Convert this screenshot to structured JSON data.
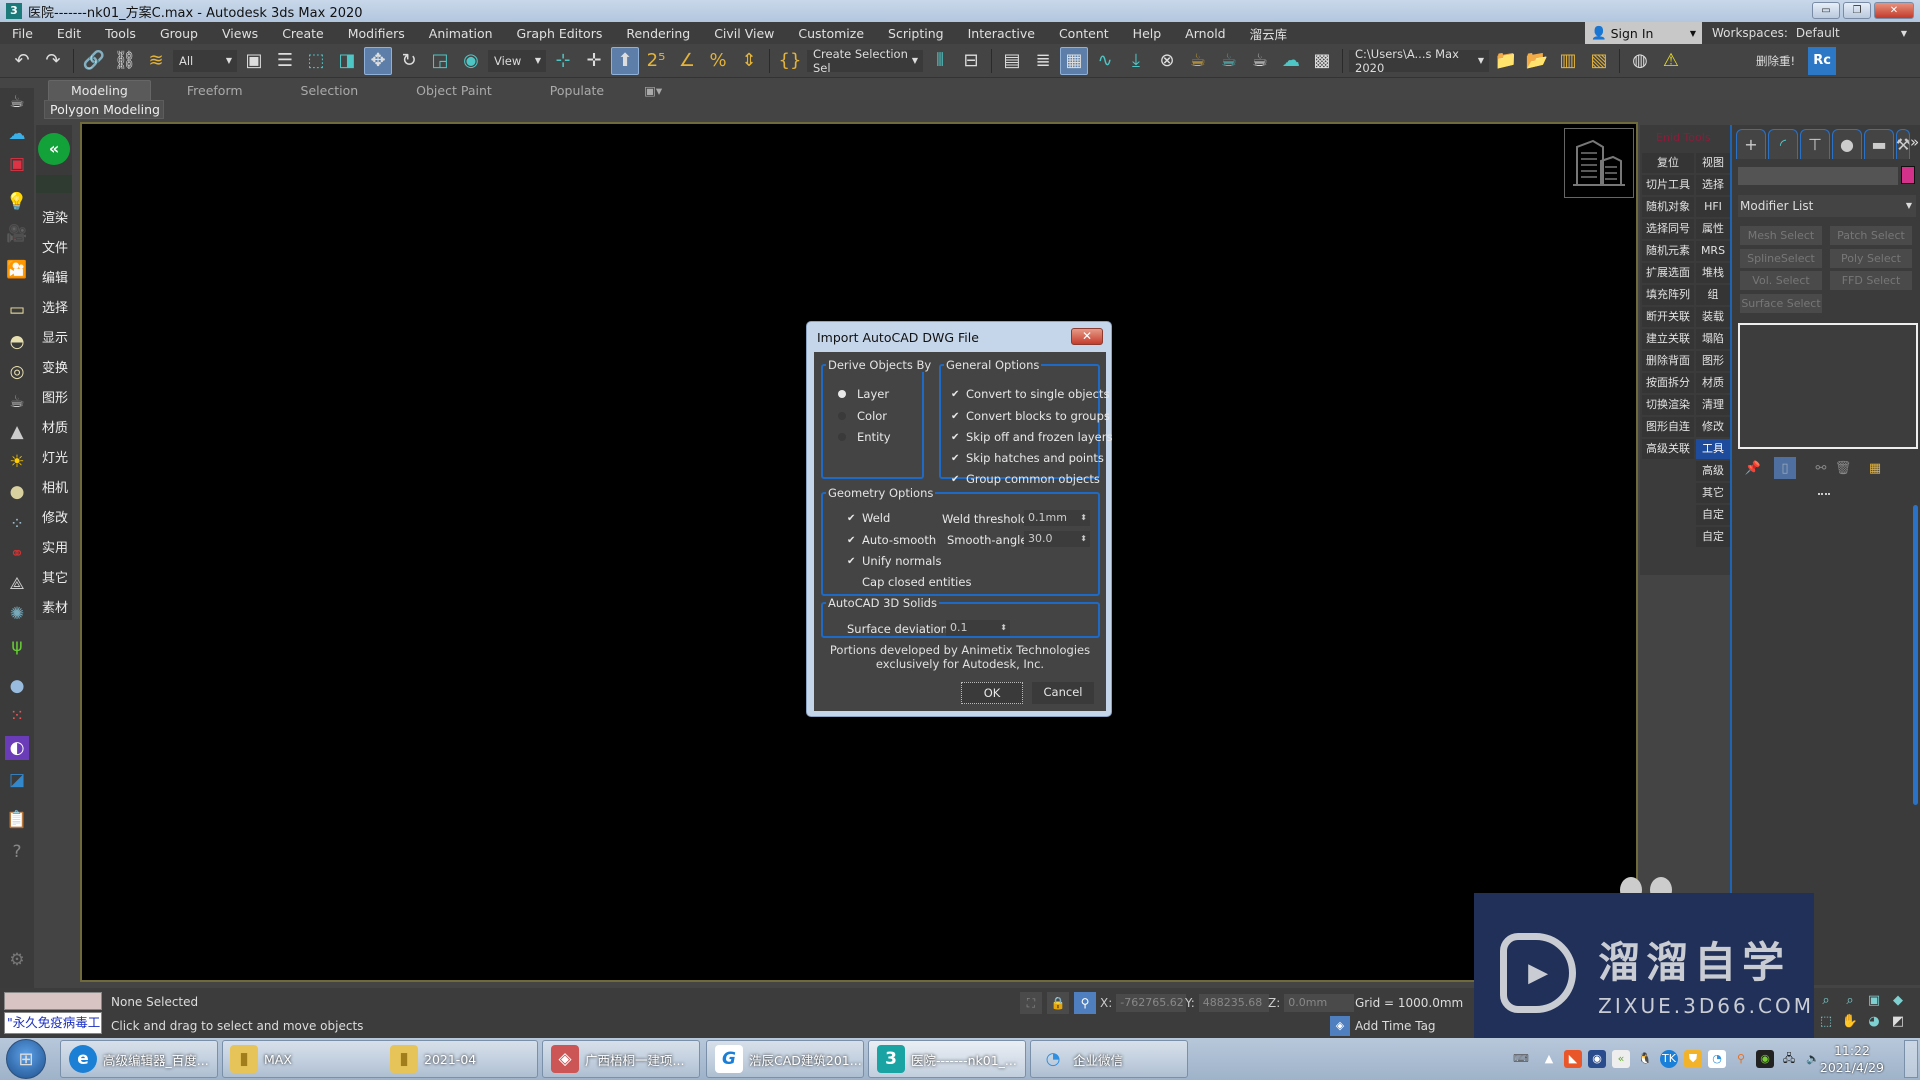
{
  "window": {
    "title": "医院-------nk01_方案C.max - Autodesk 3ds Max 2020",
    "app_icon": "3",
    "minimize": "▭",
    "restore": "❐",
    "close": "✕"
  },
  "menu": {
    "items": [
      "File",
      "Edit",
      "Tools",
      "Group",
      "Views",
      "Create",
      "Modifiers",
      "Animation",
      "Graph Editors",
      "Rendering",
      "Civil View",
      "Customize",
      "Scripting",
      "Interactive",
      "Content",
      "Help",
      "Arnold",
      "溜云库"
    ],
    "sign_in": "Sign In",
    "workspaces_label": "Workspaces:",
    "workspaces_value": "Default"
  },
  "toolbar": {
    "selection_filter": "All",
    "reference_coord": "View",
    "named_selection": "Create Selection Sel",
    "project_path": "C:\\Users\\A...s Max 2020",
    "extra_label": "删除重!",
    "rc_label": "Rc"
  },
  "ribbon": {
    "tabs": [
      "Modeling",
      "Freeform",
      "Selection",
      "Object Paint",
      "Populate"
    ],
    "active_tab": "Modeling",
    "sub_label": "Polygon Modeling"
  },
  "left_plugin": {
    "logo_caption": "",
    "items": [
      "渲染",
      "文件",
      "编辑",
      "选择",
      "显示",
      "变换",
      "图形",
      "材质",
      "灯光",
      "相机",
      "修改",
      "实用",
      "其它",
      "素材"
    ]
  },
  "right_plugin": {
    "title": "Enid Tools",
    "rows": [
      [
        "复位",
        "视图"
      ],
      [
        "切片工具",
        "选择"
      ],
      [
        "随机对象",
        "HFI"
      ],
      [
        "选择同号",
        "属性"
      ],
      [
        "随机元素",
        "MRS"
      ],
      [
        "扩展选面",
        "堆栈"
      ],
      [
        "填充阵列",
        "组"
      ],
      [
        "断开关联",
        "装载"
      ],
      [
        "建立关联",
        "塌陷"
      ],
      [
        "删除背面",
        "图形"
      ],
      [
        "按面拆分",
        "材质"
      ],
      [
        "切换渲染",
        "清理"
      ],
      [
        "图形自连",
        "修改"
      ],
      [
        "高级关联",
        "工具"
      ],
      [
        "",
        "高级"
      ],
      [
        "",
        "其它"
      ],
      [
        "",
        "自定"
      ],
      [
        "",
        "自定"
      ]
    ],
    "selected": "工具"
  },
  "command_panel": {
    "tabs": [
      "create-icon",
      "modify-icon",
      "hierarchy-icon",
      "motion-icon",
      "display-icon",
      "utilities-icon"
    ],
    "more": "»",
    "object_color": "#d4318a",
    "modifier_list": "Modifier List",
    "modifier_buttons": [
      "Mesh Select",
      "Patch Select",
      "SplineSelect",
      "Poly Select",
      "Vol. Select",
      "FFD Select",
      "Surface Select"
    ]
  },
  "dialog": {
    "title": "Import AutoCAD DWG File",
    "derive_group": "Derive Objects By",
    "derive_options": [
      {
        "label": "Layer",
        "selected": true
      },
      {
        "label": "Color",
        "selected": false
      },
      {
        "label": "Entity",
        "selected": false
      }
    ],
    "general_group": "General Options",
    "general_options": [
      {
        "label": "Convert to single objects",
        "checked": true
      },
      {
        "label": "Convert blocks to groups",
        "checked": true
      },
      {
        "label": "Skip off and frozen layers",
        "checked": true
      },
      {
        "label": "Skip hatches and points",
        "checked": true
      },
      {
        "label": "Group common objects",
        "checked": true
      }
    ],
    "geometry_group": "Geometry Options",
    "geometry_options": [
      {
        "label": "Weld",
        "checked": true
      },
      {
        "label": "Auto-smooth",
        "checked": true
      },
      {
        "label": "Unify normals",
        "checked": true
      },
      {
        "label": "Cap closed entities",
        "checked": false
      }
    ],
    "weld_threshold_label": "Weld threshold:",
    "weld_threshold_value": "0.1mm",
    "smooth_angle_label": "Smooth-angle:",
    "smooth_angle_value": "30.0",
    "solids_group": "AutoCAD 3D Solids",
    "surface_deviation_label": "Surface deviation:",
    "surface_deviation_value": "0.1",
    "credit_line1": "Portions developed by Animetix Technologies",
    "credit_line2": "exclusively for Autodesk, Inc.",
    "ok": "OK",
    "cancel": "Cancel"
  },
  "status": {
    "maxscript_text": "\"永久免疫病毒工",
    "selection": "None Selected",
    "prompt": "Click and drag to select and move objects",
    "x_label": "X:",
    "x_value": "-762765.62",
    "y_label": "Y:",
    "y_value": "488235.68",
    "z_label": "Z:",
    "z_value": "0.0mm",
    "grid": "Grid = 1000.0mm",
    "add_time_tag": "Add Time Tag"
  },
  "taskbar": {
    "items": [
      {
        "label": "高级编辑器_百度...",
        "icon": "edge-icon"
      },
      {
        "label": "MAX",
        "icon": "folder-icon"
      },
      {
        "label": "2021-04",
        "icon": "folder-icon"
      },
      {
        "label": "广西梧桐一建项...",
        "icon": "app-icon"
      },
      {
        "label": "浩辰CAD建筑201...",
        "icon": "gstarcad-icon"
      },
      {
        "label": "医院-------nk01_...",
        "icon": "3dsmax-icon"
      },
      {
        "label": "企业微信",
        "icon": "wecom-icon"
      }
    ],
    "time": "11:22",
    "date": "2021/4/29"
  },
  "watermark": {
    "cn": "溜溜自学",
    "en": "ZIXUE.3D66.COM"
  }
}
